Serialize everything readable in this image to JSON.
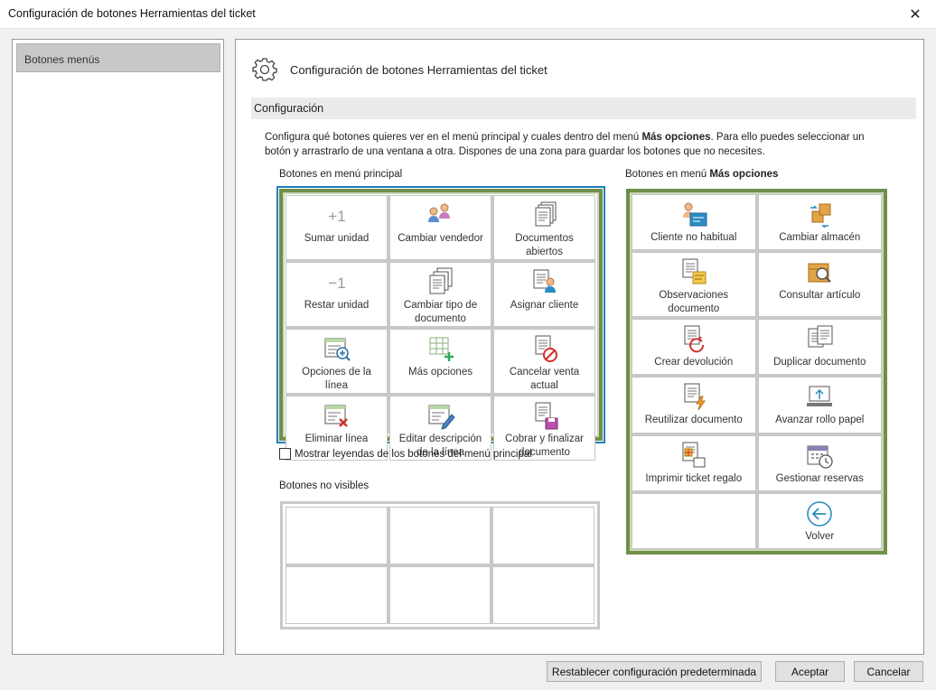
{
  "window": {
    "title": "Configuración de botones Herramientas del ticket",
    "close_glyph": "✕"
  },
  "sidebar": {
    "items": [
      {
        "label": "Botones menús"
      }
    ]
  },
  "main": {
    "header_title": "Configuración de botones Herramientas del ticket",
    "section": "Configuración",
    "description": {
      "part1": "Configura qué botones quieres ver en el menú principal y cuales dentro del menú ",
      "bold": "Más opciones",
      "part2": ". Para ello puedes seleccionar un botón y arrastrarlo de una ventana a otra. Dispones de una zona para guardar los botones que no necesites."
    },
    "principal_label": "Botones en menú principal",
    "mas_label_prefix": "Botones en menú ",
    "mas_label_bold": "Más opciones",
    "principal_buttons": [
      {
        "label": "Sumar unidad",
        "icon": "plus-one-icon"
      },
      {
        "label": "Cambiar vendedor",
        "icon": "people-icon"
      },
      {
        "label": "Documentos abiertos",
        "icon": "documents-stack-icon"
      },
      {
        "label": "Restar unidad",
        "icon": "minus-one-icon"
      },
      {
        "label": "Cambiar tipo de documento",
        "icon": "document-type-icon"
      },
      {
        "label": "Asignar cliente",
        "icon": "assign-client-icon"
      },
      {
        "label": "Opciones de la línea",
        "icon": "line-options-icon"
      },
      {
        "label": "Más opciones",
        "icon": "more-options-icon"
      },
      {
        "label": "Cancelar venta actual",
        "icon": "cancel-sale-icon"
      },
      {
        "label": "Eliminar línea",
        "icon": "delete-line-icon"
      },
      {
        "label": "Editar descripción de la línea",
        "icon": "edit-description-icon"
      },
      {
        "label": "Cobrar y finalizar documento",
        "icon": "checkout-icon"
      }
    ],
    "checkbox_label": "Mostrar leyendas de los botones del menú principal",
    "checkbox_checked": false,
    "hidden_label": "Botones no visibles",
    "mas_buttons": [
      {
        "label": "Cliente no habitual",
        "icon": "occasional-client-icon"
      },
      {
        "label": "Cambiar almacén",
        "icon": "change-warehouse-icon"
      },
      {
        "label": "Observaciones documento",
        "icon": "document-notes-icon"
      },
      {
        "label": "Consultar artículo",
        "icon": "search-article-icon"
      },
      {
        "label": "Crear devolución",
        "icon": "return-icon"
      },
      {
        "label": "Duplicar documento",
        "icon": "duplicate-document-icon"
      },
      {
        "label": "Reutilizar documento",
        "icon": "reuse-document-icon"
      },
      {
        "label": "Avanzar rollo papel",
        "icon": "advance-paper-icon"
      },
      {
        "label": "Imprimir ticket regalo",
        "icon": "gift-ticket-icon"
      },
      {
        "label": "Gestionar reservas",
        "icon": "reservations-icon"
      },
      {
        "label": "",
        "icon": ""
      },
      {
        "label": "Volver",
        "icon": "back-arrow-icon"
      }
    ]
  },
  "footer": {
    "reset": "Restablecer configuración predeterminada",
    "accept": "Aceptar",
    "cancel": "Cancelar"
  },
  "colors": {
    "blue_frame": "#1f7fbf",
    "green_frame": "#6f8f4a",
    "accent_blue": "#2b8cc4"
  }
}
